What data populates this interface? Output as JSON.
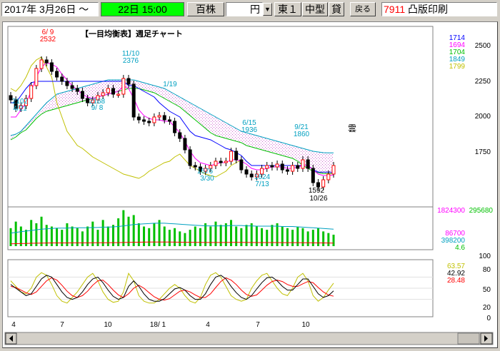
{
  "toolbar": {
    "date_range_start": "2017年 3月26日 ～",
    "current_time": "22日 15:00",
    "unit": "百株",
    "currency": "円",
    "market": "東１",
    "size_class": "中型",
    "margin_flag": "貸",
    "back_button": "戻る",
    "ticker_code": "7911",
    "company_name": "凸版印刷"
  },
  "chart": {
    "title": "【一目均衡表】週足チャート",
    "kumo_label": "雲",
    "price_axis_ticks": [
      "2500",
      "2250",
      "2000",
      "1750"
    ],
    "legend_values": [
      {
        "text": "1714",
        "color": "#0000ff"
      },
      {
        "text": "1694",
        "color": "#ff00ff"
      },
      {
        "text": "1704",
        "color": "#00c000"
      },
      {
        "text": "1849",
        "color": "#00a0c0"
      },
      {
        "text": "1799",
        "color": "#c0c000"
      }
    ],
    "volume_labels": {
      "left": "1824300",
      "right": "295680",
      "v1": "86700",
      "v2": "398200",
      "v3": "4.6"
    },
    "oscillator_ticks": [
      "100",
      "80",
      "50",
      "20",
      "0"
    ],
    "oscillator_values": [
      {
        "text": "63.57",
        "color": "#c0c000"
      },
      {
        "text": "42.92",
        "color": "#000000"
      },
      {
        "text": "28.48",
        "color": "#ff0000"
      }
    ],
    "x_ticks": [
      "4",
      "7",
      "10",
      "18/ 1",
      "4",
      "7",
      "10"
    ],
    "annotations": [
      {
        "text": "6/ 9",
        "color": "#ff0000"
      },
      {
        "text": "2532",
        "color": "#ff0000"
      },
      {
        "text": "11/10",
        "color": "#00a0c0"
      },
      {
        "text": "2376",
        "color": "#00a0c0"
      },
      {
        "text": "2102",
        "color": "#00a0c0"
      },
      {
        "text": "4/21",
        "color": "#00a0c0"
      },
      {
        "text": "2168",
        "color": "#00a0c0"
      },
      {
        "text": "9/ 8",
        "color": "#00a0c0"
      },
      {
        "text": "1/19",
        "color": "#00a0c0"
      },
      {
        "text": "6/15",
        "color": "#00a0c0"
      },
      {
        "text": "1936",
        "color": "#00a0c0"
      },
      {
        "text": "9/21",
        "color": "#00a0c0"
      },
      {
        "text": "1860",
        "color": "#00a0c0"
      },
      {
        "text": "1676",
        "color": "#00a0c0"
      },
      {
        "text": "3/30",
        "color": "#00a0c0"
      },
      {
        "text": "1624",
        "color": "#00a0c0"
      },
      {
        "text": "7/13",
        "color": "#00a0c0"
      },
      {
        "text": "1592",
        "color": "#000000"
      },
      {
        "text": "10/26",
        "color": "#000000"
      }
    ]
  },
  "chart_data": {
    "type": "line",
    "title": "【一目均衡表】週足チャート",
    "y_price_range": [
      1600,
      2600
    ],
    "y_oscillator_range": [
      0,
      100
    ],
    "closes": [
      2220,
      2160,
      2180,
      2230,
      2320,
      2440,
      2500,
      2480,
      2420,
      2380,
      2350,
      2320,
      2300,
      2280,
      2230,
      2200,
      2220,
      2250,
      2270,
      2300,
      2260,
      2260,
      2370,
      2330,
      2100,
      2080,
      2070,
      2060,
      2100,
      2110,
      2080,
      2070,
      1990,
      1950,
      1870,
      1760,
      1750,
      1720,
      1740,
      1760,
      1790,
      1780,
      1790,
      1860,
      1800,
      1730,
      1700,
      1680,
      1700,
      1740,
      1760,
      1750,
      1770,
      1730,
      1720,
      1760,
      1740,
      1800,
      1740,
      1640,
      1610,
      1660,
      1700,
      1760
    ],
    "tenkan": [
      2100,
      2100,
      2150,
      2200,
      2280,
      2380,
      2450,
      2480,
      2470,
      2450,
      2400,
      2360,
      2320,
      2290,
      2260,
      2240,
      2230,
      2240,
      2250,
      2260,
      2270,
      2280,
      2320,
      2300,
      2230,
      2150,
      2110,
      2090,
      2080,
      2080,
      2070,
      2070,
      2030,
      1990,
      1930,
      1860,
      1810,
      1780,
      1770,
      1760,
      1770,
      1780,
      1780,
      1800,
      1800,
      1790,
      1770,
      1740,
      1730,
      1730,
      1740,
      1750,
      1750,
      1750,
      1740,
      1740,
      1750,
      1760,
      1760,
      1730,
      1700,
      1690,
      1690,
      1694
    ],
    "kijun": [
      2200,
      2200,
      2250,
      2300,
      2340,
      2350,
      2350,
      2350,
      2350,
      2350,
      2350,
      2350,
      2350,
      2350,
      2350,
      2350,
      2350,
      2350,
      2350,
      2350,
      2350,
      2350,
      2350,
      2320,
      2320,
      2300,
      2280,
      2260,
      2240,
      2200,
      2170,
      2140,
      2120,
      2100,
      2050,
      2000,
      1970,
      1960,
      1950,
      1940,
      1920,
      1900,
      1880,
      1870,
      1850,
      1830,
      1790,
      1760,
      1760,
      1760,
      1760,
      1760,
      1760,
      1760,
      1760,
      1760,
      1760,
      1760,
      1760,
      1730,
      1714,
      1714,
      1714,
      1714
    ],
    "span_a": [
      1940,
      1960,
      1990,
      2010,
      2050,
      2090,
      2120,
      2140,
      2150,
      2160,
      2170,
      2180,
      2190,
      2200,
      2210,
      2220,
      2230,
      2240,
      2250,
      2260,
      2270,
      2280,
      2290,
      2300,
      2300,
      2300,
      2290,
      2280,
      2270,
      2250,
      2230,
      2210,
      2190,
      2170,
      2140,
      2110,
      2080,
      2050,
      2020,
      1990,
      1970,
      1960,
      1950,
      1940,
      1930,
      1920,
      1900,
      1890,
      1880,
      1870,
      1860,
      1850,
      1840,
      1830,
      1820,
      1810,
      1790,
      1760,
      1740,
      1720,
      1710,
      1704,
      1704,
      1704
    ],
    "span_b": [
      1970,
      1980,
      2000,
      2040,
      2080,
      2120,
      2160,
      2200,
      2230,
      2260,
      2270,
      2280,
      2290,
      2300,
      2310,
      2320,
      2330,
      2340,
      2350,
      2360,
      2360,
      2360,
      2360,
      2360,
      2360,
      2350,
      2340,
      2330,
      2320,
      2310,
      2300,
      2280,
      2260,
      2240,
      2220,
      2200,
      2180,
      2160,
      2140,
      2120,
      2100,
      2080,
      2060,
      2040,
      2020,
      2000,
      1990,
      1980,
      1970,
      1960,
      1950,
      1940,
      1930,
      1920,
      1910,
      1900,
      1890,
      1880,
      1870,
      1860,
      1855,
      1850,
      1849,
      1849
    ],
    "chikou": [
      2300,
      2280,
      2320,
      2380,
      2460,
      2500,
      2520,
      2450,
      2380,
      2200,
      2100,
      2000,
      1950,
      1900,
      1880,
      1850,
      1820,
      1800,
      1780,
      1760,
      1740,
      1720,
      1700,
      1690,
      1680,
      1670,
      1690,
      1720,
      1740,
      1760,
      1780,
      1790,
      1820,
      1840,
      1800,
      1760,
      1740,
      1720,
      1700,
      1690,
      1680,
      1700,
      1720,
      1760,
      1780,
      1799
    ],
    "volume": [
      55,
      75,
      60,
      50,
      80,
      70,
      90,
      65,
      60,
      55,
      50,
      70,
      60,
      55,
      45,
      60,
      75,
      50,
      80,
      60,
      65,
      85,
      110,
      90,
      95,
      70,
      60,
      55,
      70,
      80,
      60,
      50,
      55,
      45,
      40,
      50,
      60,
      55,
      70,
      60,
      75,
      65,
      70,
      80,
      60,
      55,
      65,
      70,
      60,
      55,
      50,
      65,
      70,
      60,
      55,
      50,
      60,
      55,
      45,
      50,
      55,
      45,
      40,
      35
    ],
    "volume_ma": [
      40,
      42,
      44,
      46,
      48,
      50,
      52,
      53,
      54,
      55,
      55,
      55,
      56,
      56,
      56,
      56,
      57,
      57,
      58,
      58,
      59,
      60,
      62,
      64,
      66,
      67,
      68,
      69,
      70,
      70,
      70,
      69,
      68,
      67,
      66,
      65,
      64,
      63,
      62,
      62,
      62,
      62,
      62,
      63,
      63,
      63,
      62,
      62,
      61,
      61,
      61,
      61,
      61,
      60,
      60,
      60,
      59,
      58,
      57,
      56,
      55,
      54,
      53,
      52
    ],
    "osc_yellow": [
      70,
      55,
      40,
      35,
      50,
      80,
      92,
      85,
      60,
      30,
      15,
      10,
      25,
      40,
      60,
      80,
      90,
      70,
      40,
      20,
      12,
      15,
      40,
      90,
      70,
      30,
      15,
      10,
      10,
      20,
      35,
      50,
      60,
      50,
      30,
      15,
      10,
      25,
      60,
      85,
      92,
      80,
      55,
      30,
      20,
      15,
      20,
      50,
      70,
      85,
      90,
      70,
      50,
      35,
      30,
      50,
      80,
      90,
      70,
      30,
      15,
      25,
      45,
      63.57
    ],
    "osc_black": [
      60,
      50,
      40,
      30,
      35,
      55,
      75,
      85,
      80,
      60,
      40,
      25,
      20,
      25,
      40,
      60,
      75,
      80,
      65,
      45,
      28,
      20,
      25,
      55,
      70,
      55,
      35,
      20,
      15,
      15,
      22,
      35,
      48,
      52,
      45,
      30,
      20,
      20,
      35,
      60,
      80,
      85,
      75,
      55,
      38,
      25,
      20,
      30,
      48,
      65,
      78,
      80,
      70,
      55,
      45,
      45,
      60,
      75,
      75,
      55,
      35,
      25,
      30,
      42.92
    ],
    "osc_red": [
      55,
      52,
      45,
      38,
      33,
      40,
      55,
      70,
      78,
      72,
      58,
      42,
      30,
      25,
      30,
      42,
      58,
      70,
      72,
      60,
      45,
      32,
      25,
      35,
      50,
      58,
      50,
      38,
      27,
      20,
      18,
      22,
      32,
      42,
      45,
      40,
      32,
      25,
      25,
      35,
      52,
      68,
      78,
      72,
      60,
      45,
      33,
      28,
      32,
      45,
      58,
      68,
      72,
      68,
      60,
      55,
      55,
      62,
      68,
      65,
      52,
      40,
      32,
      28.48
    ],
    "x_tick_labels": [
      "4",
      "7",
      "10",
      "18/ 1",
      "4",
      "7",
      "10"
    ],
    "kumo_color": "#e8a8e8"
  }
}
